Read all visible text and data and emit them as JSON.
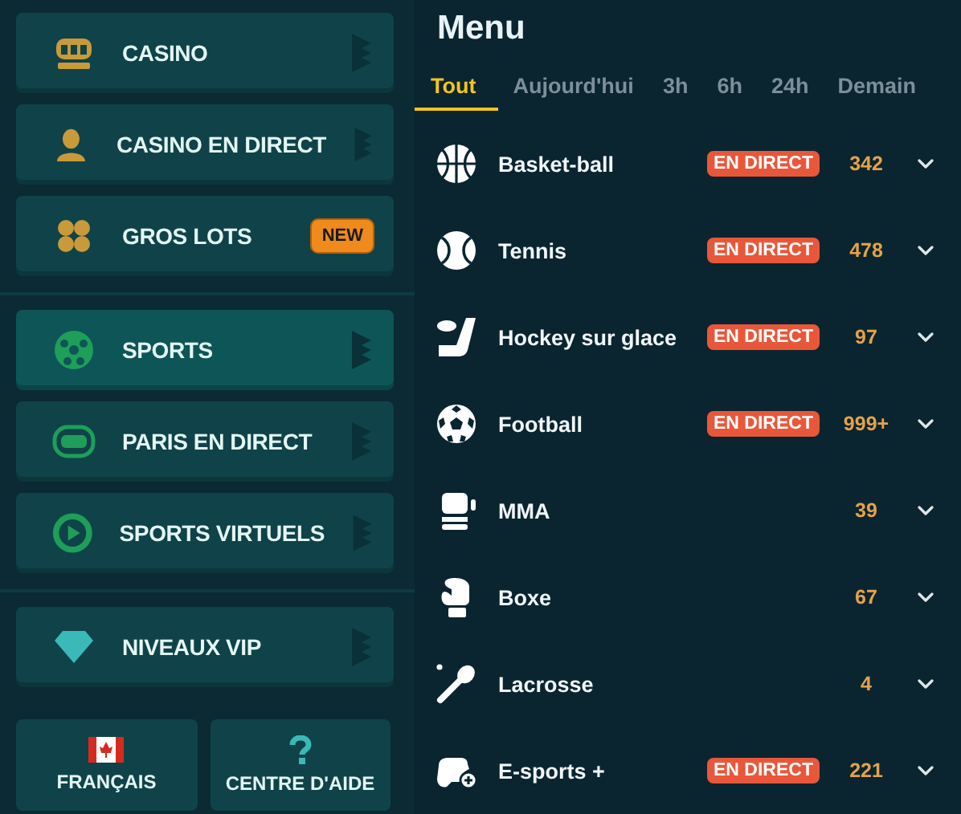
{
  "nav_groups": [
    {
      "items": [
        {
          "label": "CASINO",
          "kind": "slots",
          "selected": false
        },
        {
          "label": "CASINO EN DIRECT",
          "kind": "dealer",
          "selected": false
        },
        {
          "label": "GROS LOTS",
          "kind": "clover",
          "selected": false,
          "badge": "NEW"
        }
      ]
    },
    {
      "items": [
        {
          "label": "SPORTS",
          "kind": "ball",
          "selected": true
        },
        {
          "label": "PARIS EN DIRECT",
          "kind": "live",
          "selected": false
        },
        {
          "label": "SPORTS VIRTUELS",
          "kind": "play",
          "selected": false
        }
      ]
    },
    {
      "items": [
        {
          "label": "NIVEAUX VIP",
          "kind": "diamond",
          "selected": false
        }
      ]
    }
  ],
  "footer_buttons": [
    {
      "label": "FRANÇAIS",
      "kind": "flag"
    },
    {
      "label": "CENTRE D'AIDE",
      "kind": "help"
    }
  ],
  "menu": {
    "title": "Menu",
    "tabs": [
      {
        "label": "Tout",
        "selected": true
      },
      {
        "label": "Aujourd'hui",
        "selected": false
      },
      {
        "label": "3h",
        "selected": false
      },
      {
        "label": "6h",
        "selected": false
      },
      {
        "label": "24h",
        "selected": false
      },
      {
        "label": "Demain",
        "selected": false
      }
    ],
    "sports": [
      {
        "name": "Basket-ball",
        "kind": "basketball",
        "live": "EN DIRECT",
        "count": "342"
      },
      {
        "name": "Tennis",
        "kind": "tennis",
        "live": "EN DIRECT",
        "count": "478"
      },
      {
        "name": "Hockey sur glace",
        "kind": "hockey",
        "live": "EN DIRECT",
        "count": "97"
      },
      {
        "name": "Football",
        "kind": "soccer",
        "live": "EN DIRECT",
        "count": "999+"
      },
      {
        "name": "MMA",
        "kind": "glove",
        "count": "39"
      },
      {
        "name": "Boxe",
        "kind": "boxing",
        "count": "67"
      },
      {
        "name": "Lacrosse",
        "kind": "lacrosse",
        "count": "4"
      },
      {
        "name": "E-sports +",
        "kind": "gamepad",
        "live": "EN DIRECT",
        "count": "221"
      }
    ]
  }
}
